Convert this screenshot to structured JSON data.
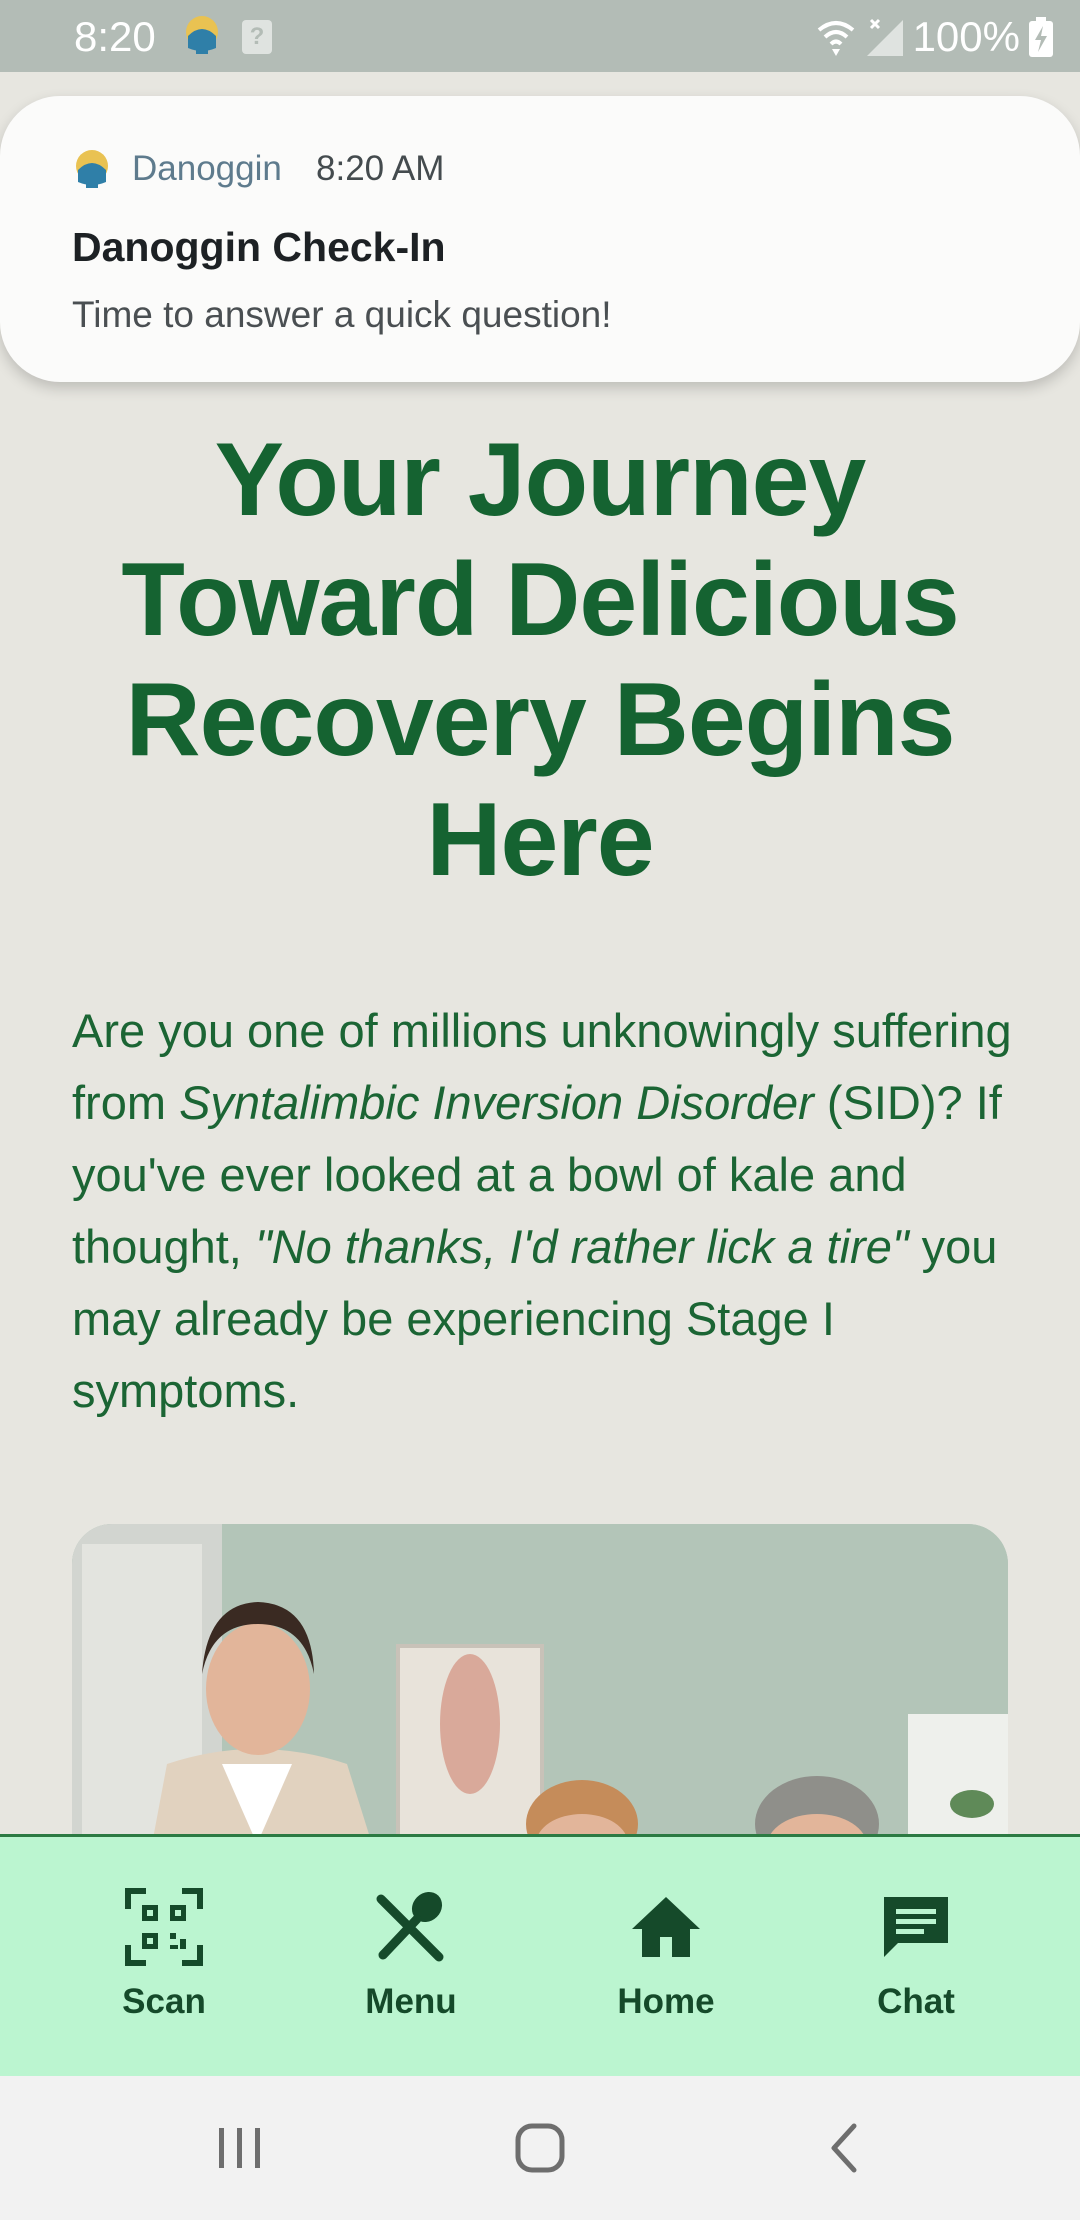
{
  "status_bar": {
    "time": "8:20",
    "battery": "100%",
    "icons": [
      "danoggin-app-icon",
      "unknown-notification-icon",
      "wifi-icon",
      "cell-signal-icon",
      "battery-charging-icon"
    ]
  },
  "notification": {
    "app_name": "Danoggin",
    "time": "8:20 AM",
    "title": "Danoggin Check-In",
    "body": "Time to answer a quick question!"
  },
  "main": {
    "headline": "Your Journey Toward Delicious Recovery Begins Here",
    "intro": {
      "part1": "Are you one of millions unknowingly suffering from ",
      "italic1": "Syntalimbic Inversion Disorder",
      "part2": " (SID)? If you've ever looked at a bowl of kale and thought, ",
      "italic2": "\"No thanks, I'd rather lick a tire\"",
      "part3": " you may already be experiencing Stage I symptoms."
    }
  },
  "bottom_nav": {
    "items": [
      {
        "label": "Scan",
        "icon": "qr-code-icon"
      },
      {
        "label": "Menu",
        "icon": "utensils-icon"
      },
      {
        "label": "Home",
        "icon": "home-icon"
      },
      {
        "label": "Chat",
        "icon": "chat-icon"
      }
    ]
  },
  "system_nav": {
    "icons": [
      "recent-apps-icon",
      "home-circle-icon",
      "back-icon"
    ]
  },
  "colors": {
    "headline": "#156331",
    "body_text": "#1b6534",
    "nav_background": "#bbf5d0",
    "nav_text": "#154a2a",
    "page_background": "#e7e6e0",
    "status_bar": "#b3bcb6"
  }
}
